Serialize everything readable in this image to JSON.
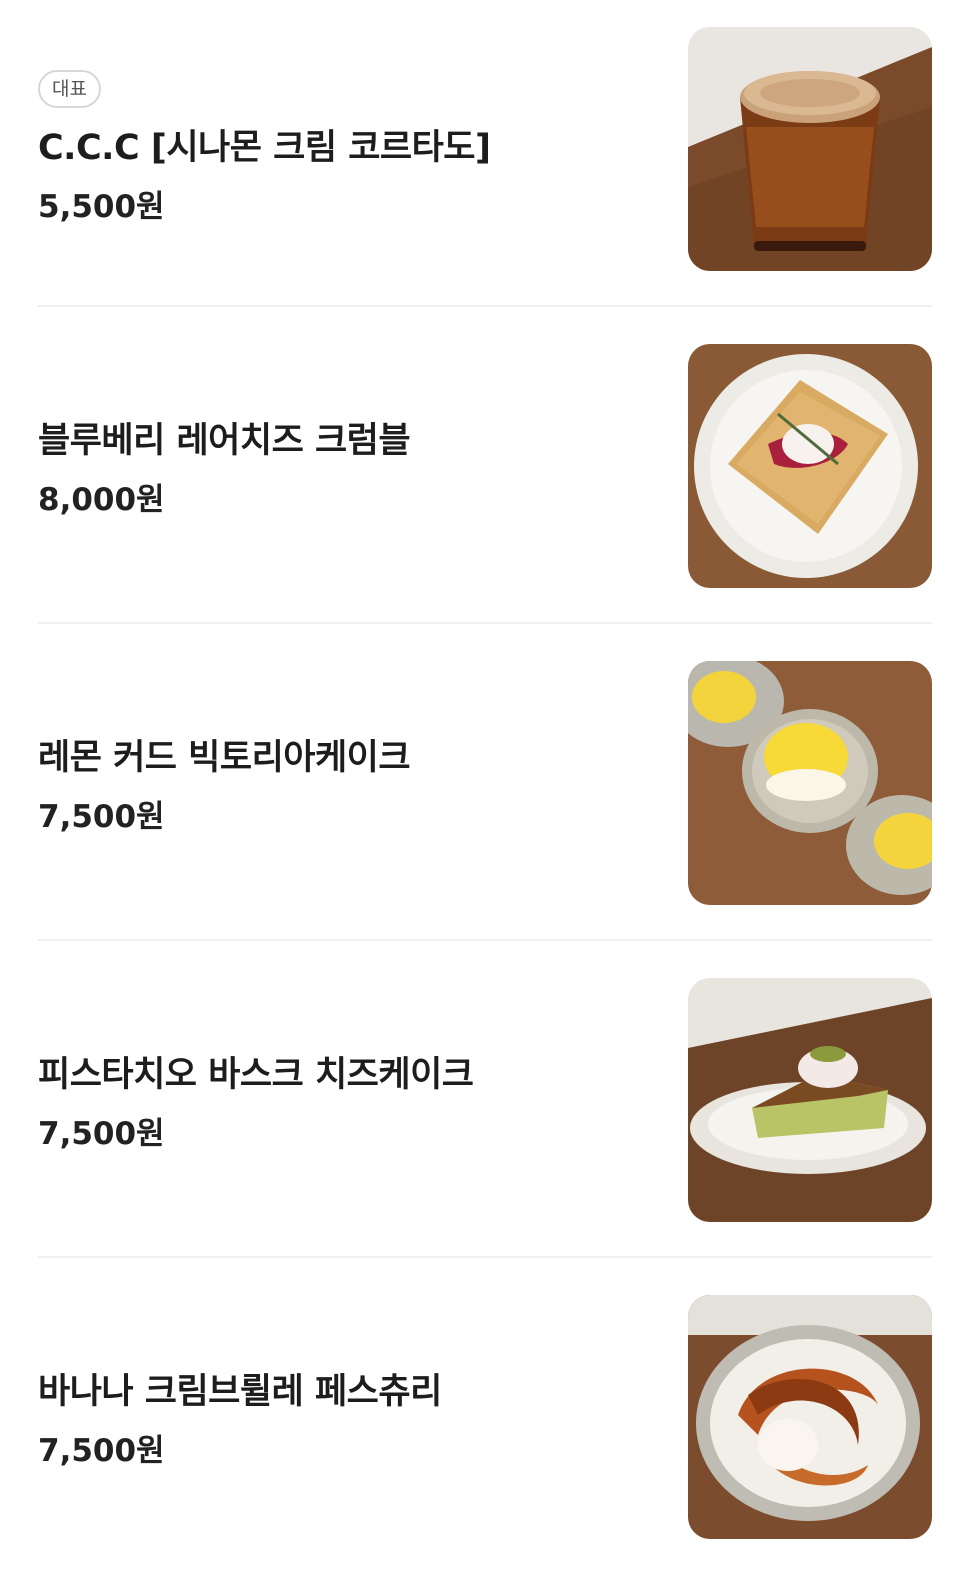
{
  "menu": {
    "items": [
      {
        "badge": "대표",
        "name": "C.C.C [시나몬 크림 코르타도]",
        "price": "5,500원"
      },
      {
        "name": "블루베리 레어치즈 크럼블",
        "price": "8,000원"
      },
      {
        "name": "레몬 커드 빅토리아케이크",
        "price": "7,500원"
      },
      {
        "name": "피스타치오 바스크 치즈케이크",
        "price": "7,500원"
      },
      {
        "name": "바나나 크림브륄레 페스츄리",
        "price": "7,500원"
      }
    ],
    "images": [
      {
        "icon": "coffee-cup-photo"
      },
      {
        "icon": "crumble-cake-photo"
      },
      {
        "icon": "lemon-cake-photo"
      },
      {
        "icon": "basque-cheesecake-photo"
      },
      {
        "icon": "banana-pastry-photo"
      }
    ]
  },
  "colors": {
    "table_wood": "#8a5a36",
    "divider": "#f0f0f0",
    "badge_border": "#d7d7d7"
  }
}
